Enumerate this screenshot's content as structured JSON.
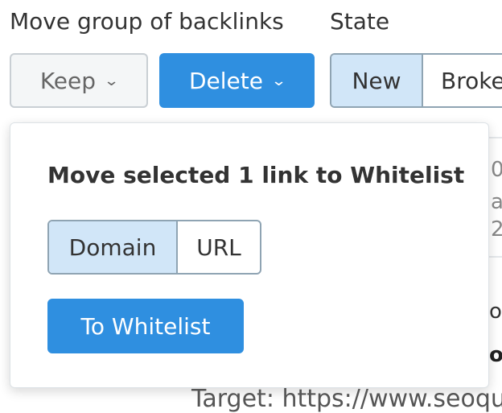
{
  "toolbar": {
    "move_group_label": "Move group of backlinks",
    "keep_label": "Keep",
    "delete_label": "Delete",
    "state_label": "State",
    "state_options": [
      "New",
      "Broke"
    ]
  },
  "popover": {
    "title": "Move selected 1 link to Whitelist",
    "scope_options": [
      "Domain",
      "URL"
    ],
    "selected_scope": "Domain",
    "submit_label": "To Whitelist"
  },
  "background": {
    "fragments": [
      "0",
      "a",
      "2",
      "o",
      "o"
    ],
    "target_text": "Target: https://www.seoqu"
  },
  "colors": {
    "primary": "#2f8fe0",
    "selected_segment": "#d1e6f8",
    "text": "#333333"
  }
}
